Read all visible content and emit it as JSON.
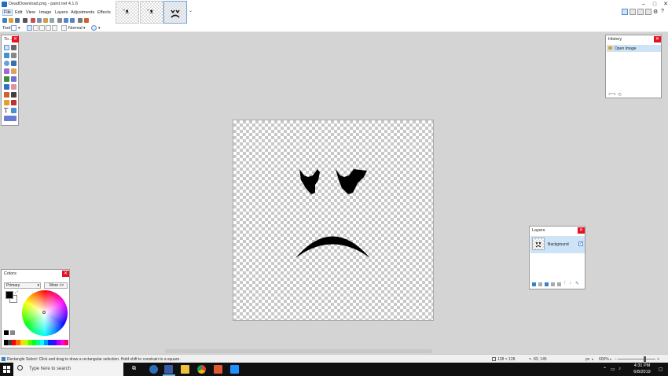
{
  "window": {
    "title": "DeadDownload.png - paint.net 4.1.6"
  },
  "menu": [
    "File",
    "Edit",
    "View",
    "Image",
    "Layers",
    "Adjustments",
    "Effects"
  ],
  "toolbar": {
    "tool_label": "Tool:",
    "blend_mode": "Normal"
  },
  "panels": {
    "tools_title": "To...",
    "history_title": "History",
    "history_items": [
      "Open Image"
    ],
    "layers_title": "Layers",
    "layers": [
      {
        "name": "Background",
        "visible": true
      }
    ],
    "colors_title": "Colors",
    "colors_mode": "Primary",
    "colors_more": "More >>"
  },
  "status": {
    "hint": "Rectangle Select: Click and drag to draw a rectangular selection. Hold shift to constrain to a square.",
    "size": "128 × 128",
    "position": "83, 145",
    "units": "px",
    "zoom": "600%"
  },
  "taskbar": {
    "search_placeholder": "Type here to search",
    "time": "4:31 PM",
    "date": "6/8/2019"
  },
  "colors": {
    "accent": "#1d6fbf",
    "selection": "#cde3f8",
    "close": "#e81123",
    "taskbar": "#101010"
  }
}
